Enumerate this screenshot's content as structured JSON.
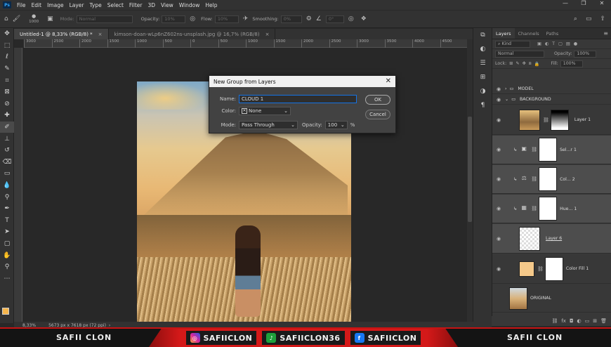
{
  "menu": {
    "logo": "Ps",
    "items": [
      "File",
      "Edit",
      "Image",
      "Layer",
      "Type",
      "Select",
      "Filter",
      "3D",
      "View",
      "Window",
      "Help"
    ],
    "window_controls": [
      "—",
      "❐",
      "✕"
    ]
  },
  "options_bar": {
    "brush_size": "1000",
    "mode_label": "Mode:",
    "mode_value": "Normal",
    "opacity_label": "Opacity:",
    "opacity_value": "10%",
    "flow_label": "Flow:",
    "flow_value": "10%",
    "smoothing_label": "Smoothing:",
    "smoothing_value": "0%",
    "angle_value": "0°"
  },
  "tabs": [
    {
      "label": "Untitled-1 @ 8,33% (RGB/8) *",
      "active": true
    },
    {
      "label": "kimson-doan-wLp6nZ602ns-unsplash.jpg @ 16,7% (RGB/8)",
      "active": false
    }
  ],
  "ruler_ticks": [
    "3000",
    "2500",
    "2000",
    "1500",
    "1000",
    "500",
    "0",
    "500",
    "1000",
    "1500",
    "2000",
    "2500",
    "3000",
    "3500",
    "4000",
    "4500"
  ],
  "status": {
    "zoom": "8,33%",
    "doc_info": "5673 px x 7618 px (72 ppi)"
  },
  "dialog": {
    "title": "New Group from Layers",
    "name_label": "Name:",
    "name_value": "CLOUD 1",
    "color_label": "Color:",
    "color_value": "None",
    "mode_label": "Mode:",
    "mode_value": "Pass Through",
    "opacity_label": "Opacity:",
    "opacity_value": "100",
    "opacity_unit": "%",
    "ok_label": "OK",
    "cancel_label": "Cancel"
  },
  "layers_panel": {
    "tabs": [
      "Layers",
      "Channels",
      "Paths"
    ],
    "kind_label": "Kind",
    "blend_mode": "Normal",
    "opacity_label": "Opacity:",
    "opacity_value": "100%",
    "lock_label": "Lock:",
    "fill_label": "Fill:",
    "fill_value": "100%",
    "layers": [
      {
        "name": "MODEL",
        "type": "group"
      },
      {
        "name": "BACKGROUND",
        "type": "group"
      },
      {
        "name": "Layer 1",
        "type": "masked"
      },
      {
        "name": "Sel...r 1",
        "type": "adjustment"
      },
      {
        "name": "Col... 2",
        "type": "adjustment"
      },
      {
        "name": "Hue... 1",
        "type": "adjustment"
      },
      {
        "name": "Layer 6",
        "type": "pixel"
      },
      {
        "name": "Color Fill 1",
        "type": "fill"
      },
      {
        "name": "ORIGINAL",
        "type": "pixel"
      }
    ]
  },
  "banner": {
    "left_text": "SAFII CLON",
    "right_text": "SAFII CLON",
    "instagram": "SAFIICLON",
    "tiktok": "SAFIICLON36",
    "facebook": "SAFIICLON"
  },
  "colors": {
    "foreground": "#f6b54b",
    "background": "#ffffff",
    "accent_blue": "#1473e6",
    "banner_red": "#d41919",
    "color_fill_swatch": "#f5c98a"
  }
}
